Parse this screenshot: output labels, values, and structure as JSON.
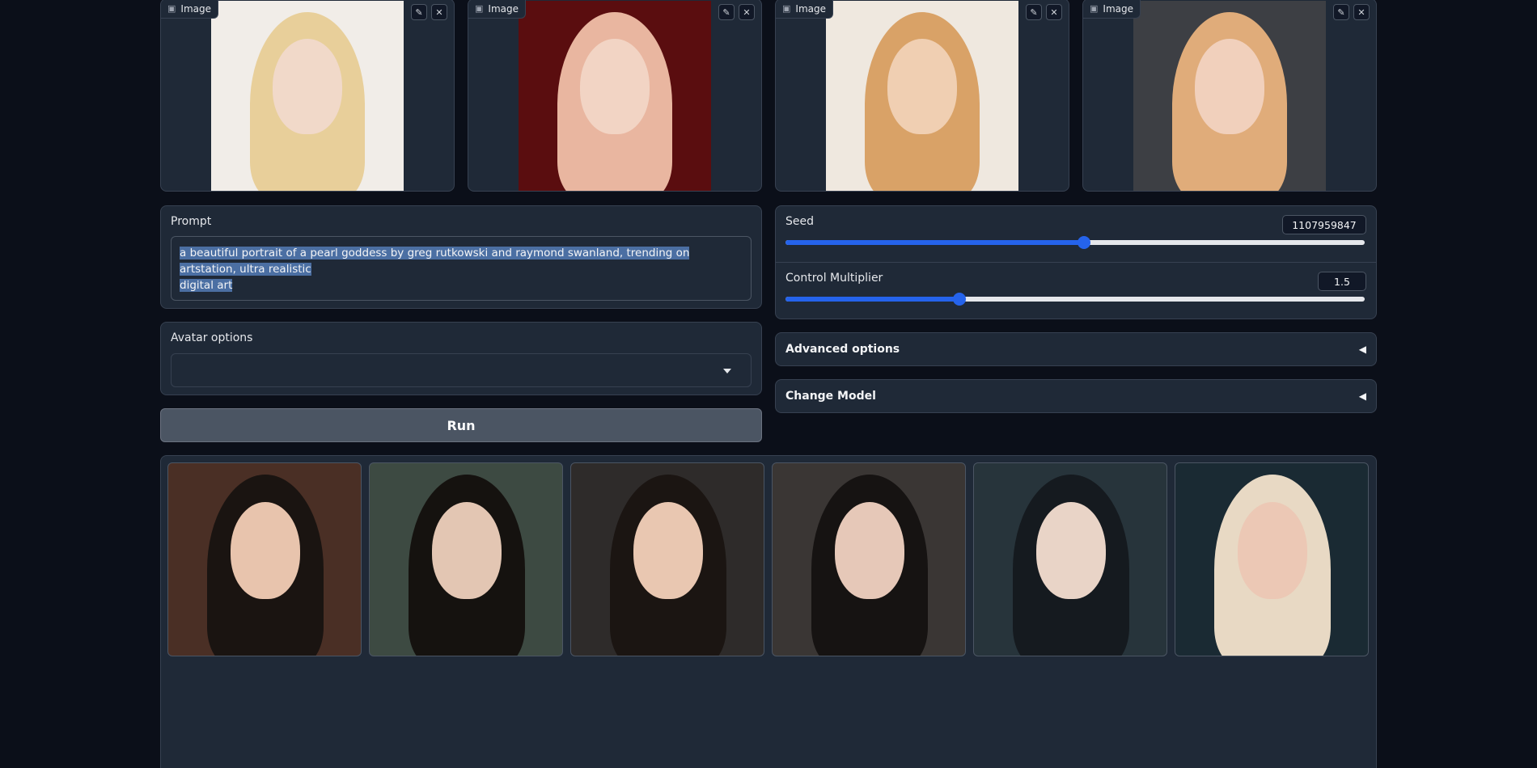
{
  "inputs": {
    "image_label": "Image",
    "cards": [
      {
        "skin": "#f1d9c9",
        "hair": "#e8cf9a",
        "bg": "#f1ede8"
      },
      {
        "skin": "#f2d4c4",
        "hair": "#e9b6a0",
        "bg": "#5a0d0f"
      },
      {
        "skin": "#f0cfb2",
        "hair": "#d9a267",
        "bg": "#efe8df"
      },
      {
        "skin": "#f1d0bc",
        "hair": "#e0ac7a",
        "bg": "#3d3f44"
      }
    ]
  },
  "prompt": {
    "label": "Prompt",
    "value_line1": "a beautiful portrait of a pearl goddess by greg rutkowski and raymond swanland, trending on artstation, ultra realistic",
    "value_line2": "digital art"
  },
  "avatar": {
    "label": "Avatar options",
    "value": ""
  },
  "run_label": "Run",
  "seed": {
    "label": "Seed",
    "value": "1107959847",
    "fraction": 0.516
  },
  "control": {
    "label": "Control Multiplier",
    "value": "1.5",
    "fraction": 0.3
  },
  "advanced_label": "Advanced options",
  "change_model_label": "Change Model",
  "accordion_arrow": "◀",
  "gallery": {
    "items": [
      {
        "skin": "#e8c4ad",
        "hair": "#1a1411",
        "bg": "#4a2f25"
      },
      {
        "skin": "#e3c6b3",
        "hair": "#15120f",
        "bg": "#3d4a42"
      },
      {
        "skin": "#e9c7b1",
        "hair": "#1b1512",
        "bg": "#2e2b2a"
      },
      {
        "skin": "#e6c8b8",
        "hair": "#161312",
        "bg": "#3a3634"
      },
      {
        "skin": "#e9d4c7",
        "hair": "#151a1f",
        "bg": "#27343b"
      },
      {
        "skin": "#ecc8b5",
        "hair": "#e8d9c4",
        "bg": "#1a2a33"
      }
    ]
  },
  "colors": {
    "page_bg": "#0b0f19",
    "panel_bg": "#1f2937",
    "accent": "#2563eb"
  }
}
